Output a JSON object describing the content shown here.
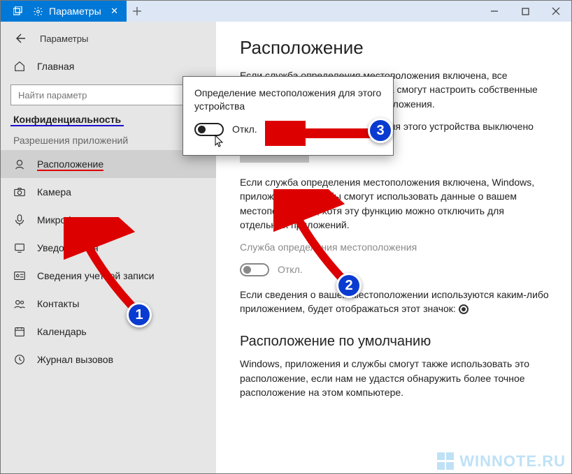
{
  "titlebar": {
    "tab_label": "Параметры"
  },
  "sidebar": {
    "page_label": "Параметры",
    "home_label": "Главная",
    "search_placeholder": "Найти параметр",
    "heading": "Конфиденциальность",
    "section_title": "Разрешения приложений",
    "items": [
      {
        "id": "location",
        "label": "Расположение"
      },
      {
        "id": "camera",
        "label": "Камера"
      },
      {
        "id": "microphone",
        "label": "Микрофон"
      },
      {
        "id": "notifications",
        "label": "Уведомления"
      },
      {
        "id": "account-info",
        "label": "Сведения учетной записи"
      },
      {
        "id": "contacts",
        "label": "Контакты"
      },
      {
        "id": "calendar",
        "label": "Календарь"
      },
      {
        "id": "call-history",
        "label": "Журнал вызовов"
      }
    ]
  },
  "content": {
    "h1": "Расположение",
    "p1": "Если служба определения местоположения включена, все пользователи данного устройства смогут настроить собственные параметры определения местоположения.",
    "status_line": "Определение местоположения для этого устройства выключено",
    "change_btn": "Изменить",
    "p2": "Если служба определения местоположения включена, Windows, приложения и службы смогут использовать данные о вашем местоположении, хотя эту функцию можно отключить для отдельных приложений.",
    "service_label": "Служба определения местоположения",
    "toggle_off": "Откл.",
    "p3_a": "Если сведения о вашем местоположении используются каким-либо приложением, будет отображаться этот значок: ",
    "h2": "Расположение по умолчанию",
    "p4": "Windows, приложения и службы смогут также использовать это расположение, если нам не удастся обнаружить более точное расположение на этом компьютере."
  },
  "popup": {
    "title": "Определение местоположения для этого устройства",
    "toggle_off": "Откл."
  },
  "annotations": {
    "n1": "1",
    "n2": "2",
    "n3": "3"
  },
  "watermark": "WINNOTE.RU"
}
